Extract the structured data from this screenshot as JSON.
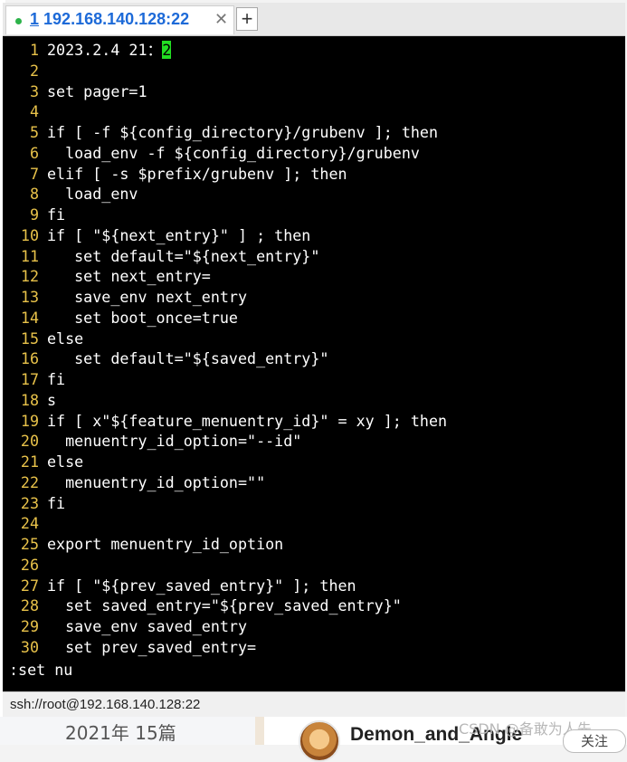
{
  "tab": {
    "number": "1",
    "title": "192.168.140.128:22",
    "close_glyph": "✕",
    "add_glyph": "+"
  },
  "terminal": {
    "lines": [
      {
        "n": "1",
        "text": "2023.2.4 21：2",
        "cursor_char": "2"
      },
      {
        "n": "2",
        "text": ""
      },
      {
        "n": "3",
        "text": "set pager=1"
      },
      {
        "n": "4",
        "text": ""
      },
      {
        "n": "5",
        "text": "if [ -f ${config_directory}/grubenv ]; then"
      },
      {
        "n": "6",
        "text": "  load_env -f ${config_directory}/grubenv"
      },
      {
        "n": "7",
        "text": "elif [ -s $prefix/grubenv ]; then"
      },
      {
        "n": "8",
        "text": "  load_env"
      },
      {
        "n": "9",
        "text": "fi"
      },
      {
        "n": "10",
        "text": "if [ \"${next_entry}\" ] ; then"
      },
      {
        "n": "11",
        "text": "   set default=\"${next_entry}\""
      },
      {
        "n": "12",
        "text": "   set next_entry="
      },
      {
        "n": "13",
        "text": "   save_env next_entry"
      },
      {
        "n": "14",
        "text": "   set boot_once=true"
      },
      {
        "n": "15",
        "text": "else"
      },
      {
        "n": "16",
        "text": "   set default=\"${saved_entry}\""
      },
      {
        "n": "17",
        "text": "fi"
      },
      {
        "n": "18",
        "text": "s"
      },
      {
        "n": "19",
        "text": "if [ x\"${feature_menuentry_id}\" = xy ]; then"
      },
      {
        "n": "20",
        "text": "  menuentry_id_option=\"--id\""
      },
      {
        "n": "21",
        "text": "else"
      },
      {
        "n": "22",
        "text": "  menuentry_id_option=\"\""
      },
      {
        "n": "23",
        "text": "fi"
      },
      {
        "n": "24",
        "text": ""
      },
      {
        "n": "25",
        "text": "export menuentry_id_option"
      },
      {
        "n": "26",
        "text": ""
      },
      {
        "n": "27",
        "text": "if [ \"${prev_saved_entry}\" ]; then"
      },
      {
        "n": "28",
        "text": "  set saved_entry=\"${prev_saved_entry}\""
      },
      {
        "n": "29",
        "text": "  save_env saved_entry"
      },
      {
        "n": "30",
        "text": "  set prev_saved_entry="
      }
    ],
    "command_line": ":set nu",
    "colors": {
      "background": "#000000",
      "foreground": "#ffffff",
      "line_number": "#e8c24a",
      "cursor": "#22dd22"
    }
  },
  "status_bar": {
    "text": "ssh://root@192.168.140.128:22"
  },
  "background_page": {
    "year_text": "2021年 15篇",
    "author_text": "Demon_and_Angle",
    "watermark_text": "CSDN @备敢为人先",
    "follow_text": "关注"
  }
}
